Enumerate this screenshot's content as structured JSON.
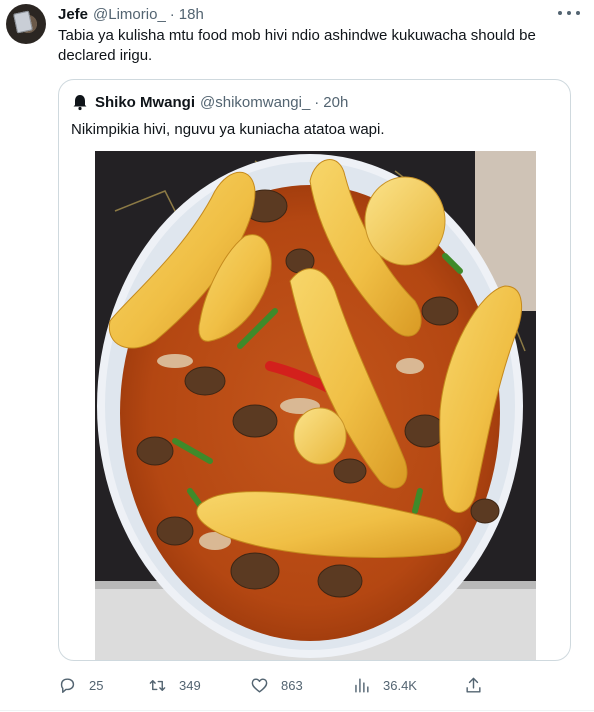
{
  "tweet": {
    "author_name": "Jefe",
    "author_handle": "@Limorio_",
    "separator": "·",
    "time": "18h",
    "text": "Tabia ya kulisha mtu food mob hivi ndio ashindwe kukuwacha should be declared irigu."
  },
  "quote": {
    "author_name": "Shiko Mwangi",
    "author_handle": "@shikomwangi_",
    "separator": "·",
    "time": "20h",
    "text": "Nikimpikia hivi, nguvu ya kuniacha atatoa wapi."
  },
  "actions": {
    "replies": "25",
    "retweets": "349",
    "likes": "863",
    "views": "36.4K"
  },
  "colors": {
    "text_primary": "#0f1419",
    "text_secondary": "#536471",
    "border": "#cfd9de",
    "stew": "#b94a14",
    "banana": "#f2c04a"
  },
  "icons": [
    "more-icon",
    "reply-icon",
    "retweet-icon",
    "like-icon",
    "views-icon",
    "share-icon"
  ]
}
